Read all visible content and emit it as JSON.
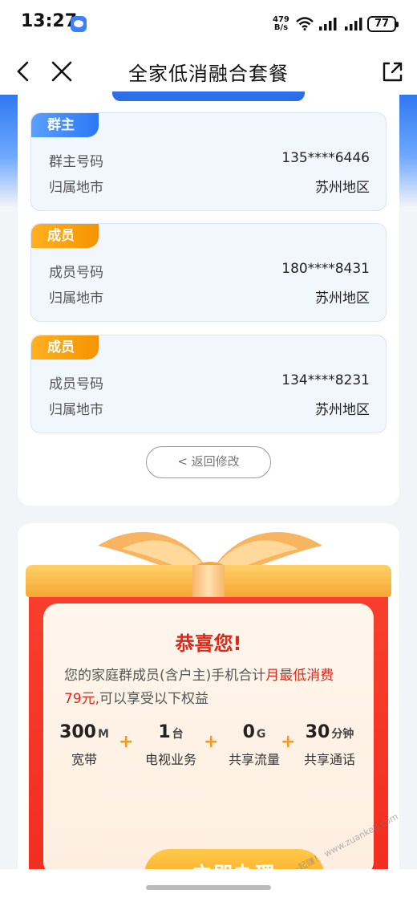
{
  "status_bar": {
    "time": "13:27",
    "net_speed_value": "479",
    "net_speed_unit": "B/s",
    "battery": "77"
  },
  "header": {
    "title": "全家低消融合套餐"
  },
  "members": [
    {
      "tag": "群主",
      "tag_color": "#2a78f5",
      "number_label": "群主号码",
      "number": "135****6446",
      "city_label": "归属地市",
      "city": "苏州地区"
    },
    {
      "tag": "成员",
      "tag_color": "#f59400",
      "number_label": "成员号码",
      "number": "180****8431",
      "city_label": "归属地市",
      "city": "苏州地区"
    },
    {
      "tag": "成员",
      "tag_color": "#f59400",
      "number_label": "成员号码",
      "number": "134****8231",
      "city_label": "归属地市",
      "city": "苏州地区"
    }
  ],
  "back_button": "< 返回修改",
  "gift": {
    "title": "恭喜您!",
    "desc_before": "您的家庭群成员(含户主)手机合计",
    "desc_highlight_1": "月最低消费",
    "desc_highlight_2": "79元,",
    "desc_after": "可以享受以下权益",
    "benefits": [
      {
        "value": "300",
        "unit": "M",
        "name": "宽带"
      },
      {
        "value": "1",
        "unit": "台",
        "name": "电视业务"
      },
      {
        "value": "0",
        "unit": "G",
        "name": "共享流量"
      },
      {
        "value": "30",
        "unit": "分钟",
        "name": "共享通话"
      }
    ],
    "plus_sign": "+",
    "apply_button": "立即办理"
  },
  "watermark": "赚客吧，有奖一起赚！ www.zuanke8.com",
  "colors": {
    "accent_blue": "#2b6ee8",
    "accent_red": "#e0281a",
    "accent_orange": "#ff9e12"
  }
}
